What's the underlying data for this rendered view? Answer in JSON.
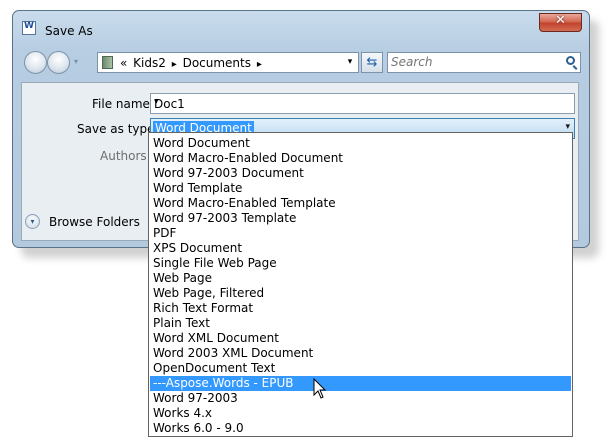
{
  "window": {
    "title": "Save As",
    "close_glyph": "✕"
  },
  "nav": {
    "history_glyph": "▾",
    "address_chevron": "«",
    "breadcrumbs": [
      "Kids2",
      "Documents"
    ],
    "crumb_separator": "▸",
    "address_dropdown_glyph": "▾",
    "refresh_glyph": "⇆",
    "search_placeholder": "Search"
  },
  "form": {
    "file_name_label": "File name:",
    "file_name_value": "Doc1",
    "save_type_label": "Save as type:",
    "save_type_value": "Word Document",
    "authors_label": "Authors:",
    "dropdown_glyph": "▾"
  },
  "footer": {
    "browse_folders_label": "Browse Folders",
    "browse_glyph": "▾"
  },
  "dropdown_list": {
    "selected_index": 16,
    "items": [
      "Word Document",
      "Word Macro-Enabled Document",
      "Word 97-2003 Document",
      "Word Template",
      "Word Macro-Enabled Template",
      "Word 97-2003 Template",
      "PDF",
      "XPS Document",
      "Single File Web Page",
      "Web Page",
      "Web Page, Filtered",
      "Rich Text Format",
      "Plain Text",
      "Word XML Document",
      "Word 2003 XML Document",
      "OpenDocument Text",
      "---Aspose.Words - EPUB",
      "Word 97-2003",
      "Works 4.x",
      "Works 6.0 - 9.0"
    ]
  },
  "colors": {
    "selection": "#3399ff",
    "close_button": "#c2412a",
    "window_frame": "#b7cde2"
  },
  "icons": {
    "app": "word-app-icon",
    "back": "back-arrow-icon",
    "forward": "forward-arrow-icon",
    "folder": "folder-icon",
    "refresh": "refresh-icon",
    "search": "search-icon",
    "browse": "chevron-down-icon",
    "cursor": "mouse-pointer-icon"
  }
}
